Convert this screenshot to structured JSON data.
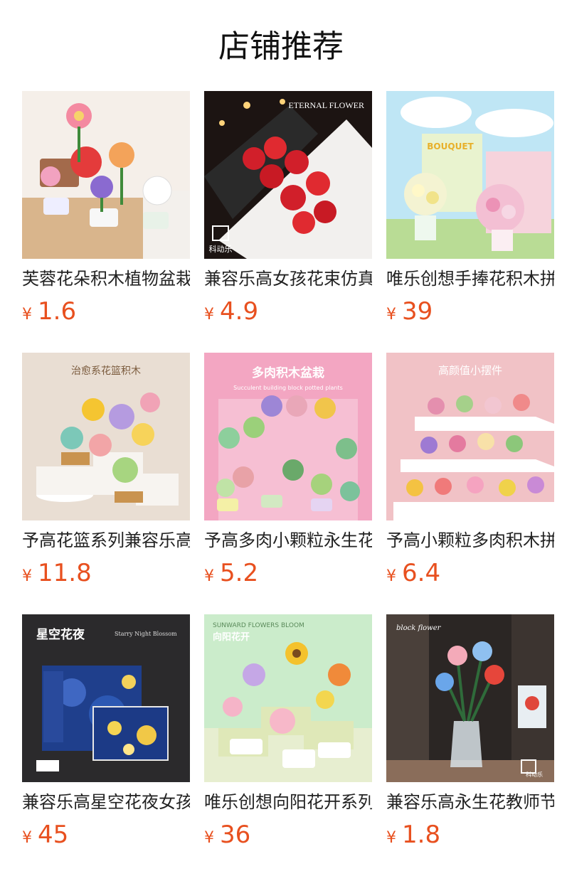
{
  "header": {
    "title": "店铺推荐"
  },
  "colors": {
    "price": "#e8501f",
    "title": "#111111"
  },
  "products": [
    {
      "name": "芙蓉花朵积木植物盆栽",
      "currency": "¥",
      "price": "1.6",
      "image_text": [
        "",
        ""
      ]
    },
    {
      "name": "兼容乐高女孩花束仿真",
      "currency": "¥",
      "price": "4.9",
      "image_text": [
        "ETERNAL FLOWER",
        "科动乐"
      ]
    },
    {
      "name": "唯乐创想手捧花积木拼",
      "currency": "¥",
      "price": "39",
      "image_text": [
        "BOUQUET",
        ""
      ]
    },
    {
      "name": "予高花篮系列兼容乐高",
      "currency": "¥",
      "price": "11.8",
      "image_text": [
        "治愈系花篮积木",
        ""
      ]
    },
    {
      "name": "予高多肉小颗粒永生花",
      "currency": "¥",
      "price": "5.2",
      "image_text": [
        "多肉积木盆栽",
        "Succulent building block potted plants"
      ]
    },
    {
      "name": "予高小颗粒多肉积木拼",
      "currency": "¥",
      "price": "6.4",
      "image_text": [
        "高颜值小摆件",
        ""
      ]
    },
    {
      "name": "兼容乐高星空花夜女孩",
      "currency": "¥",
      "price": "45",
      "image_text": [
        "星空花夜",
        "Starry Night Blossom"
      ]
    },
    {
      "name": "唯乐创想向阳花开系列",
      "currency": "¥",
      "price": "36",
      "image_text": [
        "SUNWARD FLOWERS BLOOM",
        "向阳花开"
      ]
    },
    {
      "name": "兼容乐高永生花教师节",
      "currency": "¥",
      "price": "1.8",
      "image_text": [
        "block flower",
        "科动乐"
      ]
    }
  ]
}
